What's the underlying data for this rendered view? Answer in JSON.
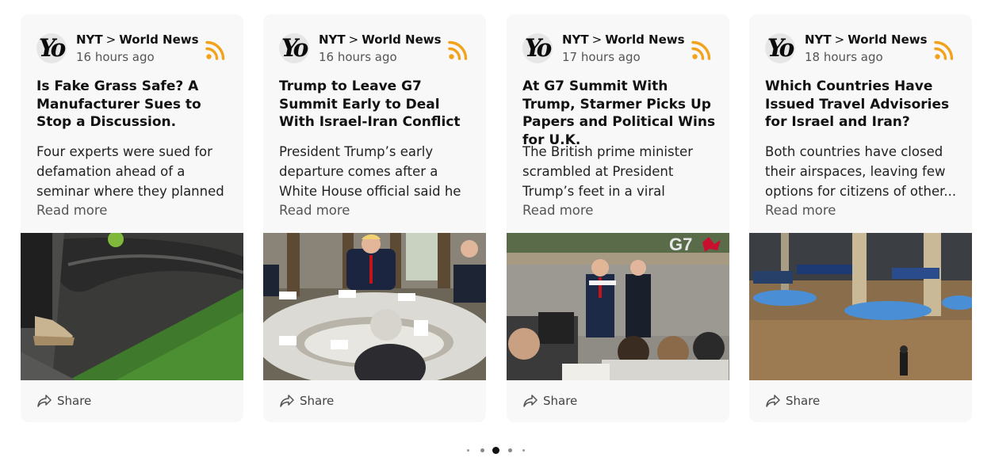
{
  "cards": [
    {
      "source": "NYT",
      "separator": ">",
      "section": "World News",
      "time": "16 hours ago",
      "title": "Is Fake Grass Safe? A Manufacturer Sues to Stop a Discussion.",
      "summary": "Four experts were sued for defamation ahead of a seminar where they planned to talk...",
      "read_more": "Read more",
      "share": "Share"
    },
    {
      "source": "NYT",
      "separator": ">",
      "section": "World News",
      "time": "16 hours ago",
      "title": "Trump to Leave G7 Summit Early to Deal With Israel-Iran Conflict",
      "summary": "President Trump’s early departure comes after a White House official said he had...",
      "read_more": "Read more",
      "share": "Share"
    },
    {
      "source": "NYT",
      "separator": ">",
      "section": "World News",
      "time": "17 hours ago",
      "title": "At G7 Summit With Trump, Starmer Picks Up Papers and Political Wins for U.K.",
      "summary": "The British prime minister scrambled at President Trump’s feet in a viral moment, but he...",
      "read_more": "Read more",
      "share": "Share"
    },
    {
      "source": "NYT",
      "separator": ">",
      "section": "World News",
      "time": "18 hours ago",
      "title": "Which Countries Have Issued Travel Advisories for Israel and Iran?",
      "summary": "Both countries have closed their airspaces, leaving few options for citizens of other...",
      "read_more": "Read more",
      "share": "Share"
    }
  ],
  "logo_text": "Yo",
  "g7_sign": "G7",
  "pagination": {
    "total": 5,
    "active": 2
  },
  "colors": {
    "rss": "#f2a21b",
    "card_bg": "#f8f8f8",
    "active_dot": "#111111",
    "inactive_dot": "#888888"
  }
}
